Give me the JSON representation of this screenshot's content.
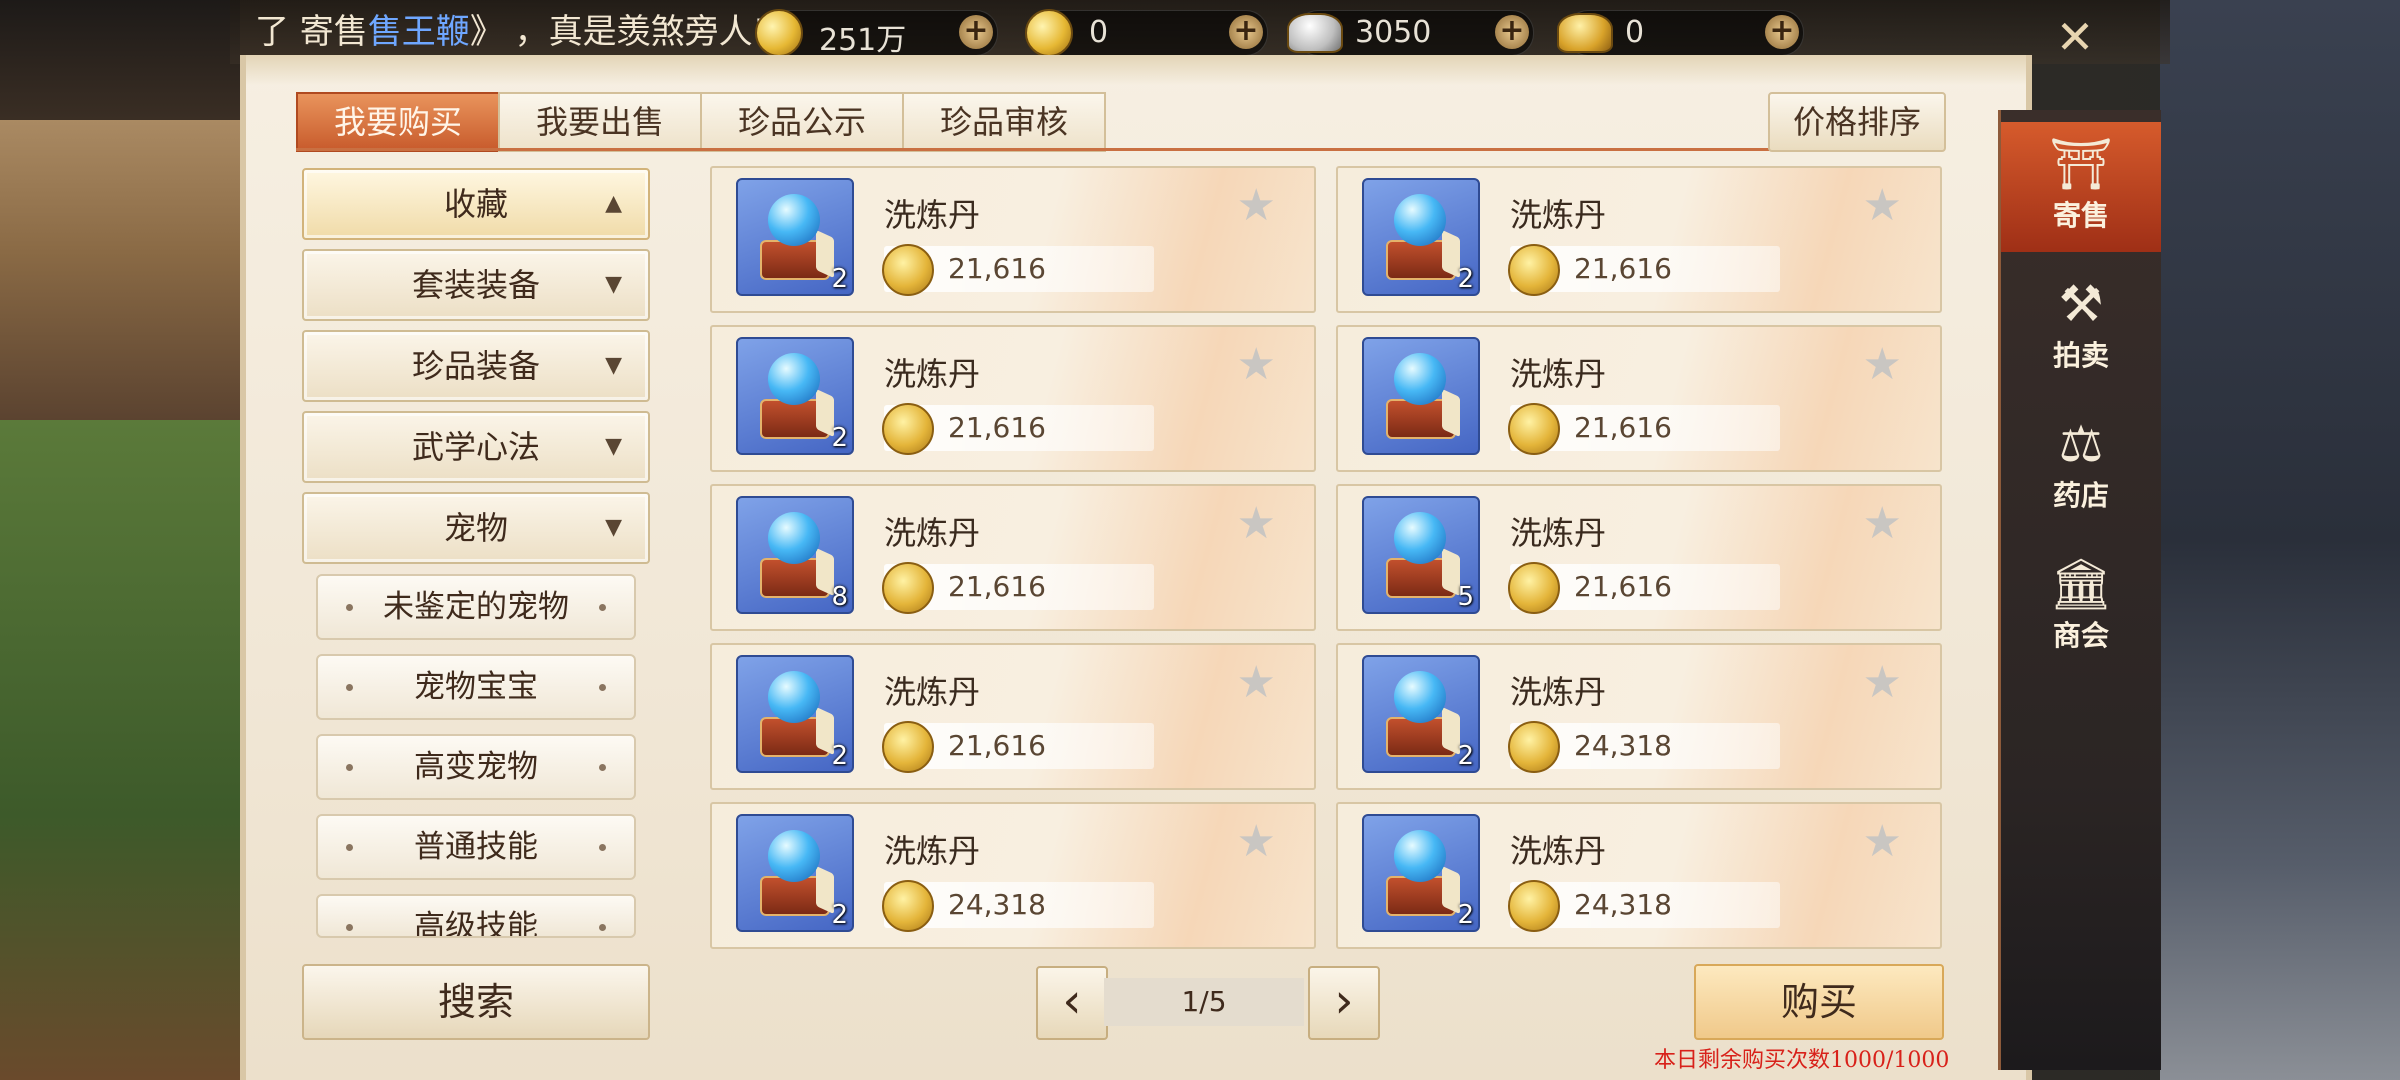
{
  "marquee": {
    "prefix": "了 寄售",
    "highlight": "售王鞭",
    "suffix": "》  ，真是羡煞旁人!"
  },
  "resources": [
    {
      "icon": "coin-icon",
      "value": "251万"
    },
    {
      "icon": "coin-icon",
      "value": "0"
    },
    {
      "icon": "silver-ingot-icon",
      "value": "3050"
    },
    {
      "icon": "gold-ingot-icon",
      "value": "0"
    }
  ],
  "close_glyph": "✕",
  "tabs": [
    "我要购买",
    "我要出售",
    "珍品公示",
    "珍品审核"
  ],
  "sort_label": "价格排序",
  "categories": [
    {
      "label": "收藏",
      "arrow": "▲"
    },
    {
      "label": "套装装备",
      "arrow": "▼"
    },
    {
      "label": "珍品装备",
      "arrow": "▼"
    },
    {
      "label": "武学心法",
      "arrow": "▼"
    },
    {
      "label": "宠物",
      "arrow": "▼"
    }
  ],
  "subcategories": [
    "未鉴定的宠物",
    "宠物宝宝",
    "高变宠物",
    "普通技能",
    "高级技能"
  ],
  "search_label": "搜索",
  "items": [
    {
      "name": "洗炼丹",
      "price": "21,616",
      "qty": "2"
    },
    {
      "name": "洗炼丹",
      "price": "21,616",
      "qty": "2"
    },
    {
      "name": "洗炼丹",
      "price": "21,616",
      "qty": "2"
    },
    {
      "name": "洗炼丹",
      "price": "21,616",
      "qty": ""
    },
    {
      "name": "洗炼丹",
      "price": "21,616",
      "qty": "8"
    },
    {
      "name": "洗炼丹",
      "price": "21,616",
      "qty": "5"
    },
    {
      "name": "洗炼丹",
      "price": "21,616",
      "qty": "2"
    },
    {
      "name": "洗炼丹",
      "price": "24,318",
      "qty": "2"
    },
    {
      "name": "洗炼丹",
      "price": "24,318",
      "qty": "2"
    },
    {
      "name": "洗炼丹",
      "price": "24,318",
      "qty": "2"
    }
  ],
  "pager": {
    "prev": "‹",
    "value": "1/5",
    "next": "›"
  },
  "buy_label": "购买",
  "quota_text": "本日剩余购买次数1000/1000",
  "side_nav": [
    {
      "label": "寄售",
      "icon": "consignment-icon",
      "glyph": "⛩"
    },
    {
      "label": "拍卖",
      "icon": "gavel-icon",
      "glyph": "⚒"
    },
    {
      "label": "药店",
      "icon": "scale-icon",
      "glyph": "⚖"
    },
    {
      "label": "商会",
      "icon": "guild-hall-icon",
      "glyph": "🏛"
    }
  ]
}
